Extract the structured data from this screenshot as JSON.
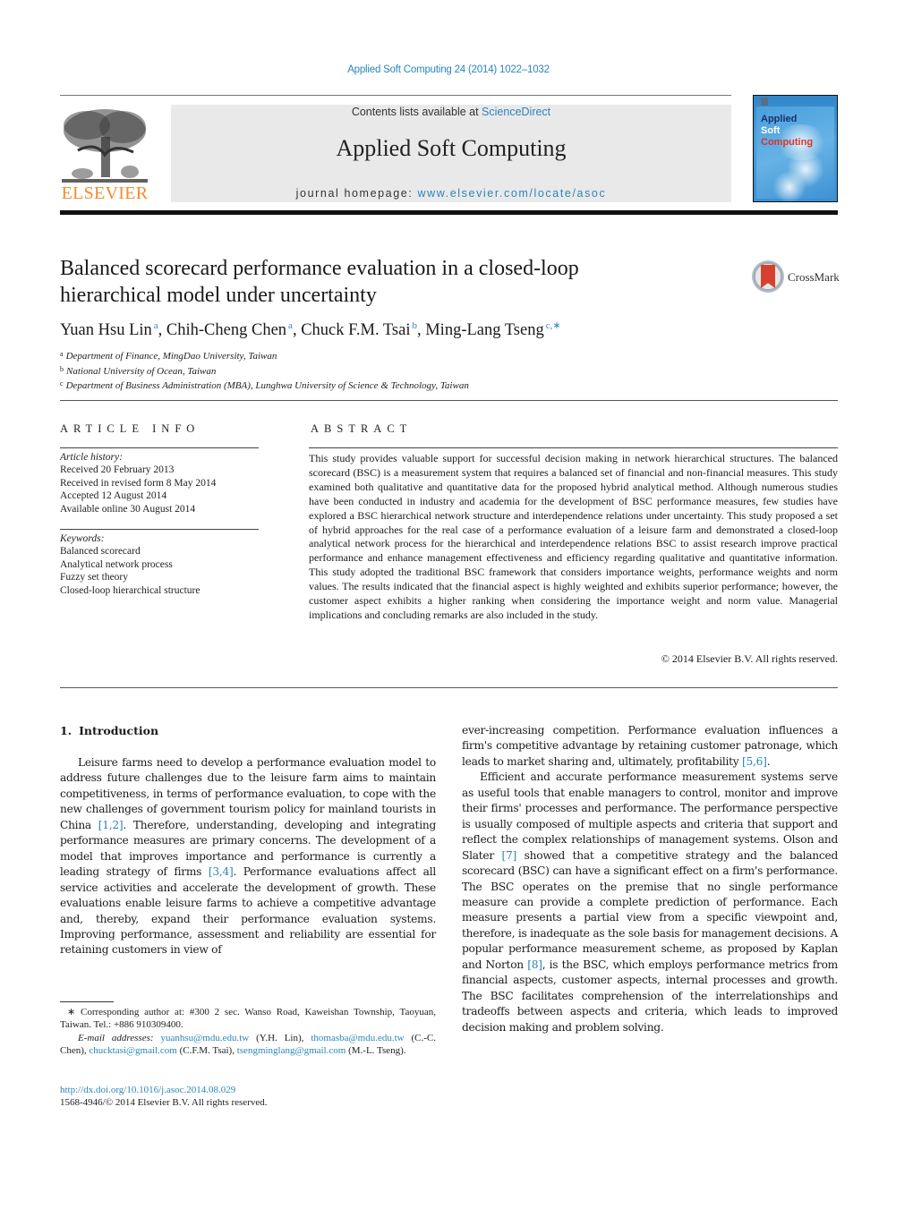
{
  "header": {
    "citation": "Applied Soft Computing 24 (2014) 1022–1032",
    "contents_prefix": "Contents lists available at ",
    "contents_link": "ScienceDirect",
    "journal_name": "Applied Soft Computing",
    "homepage_prefix": "journal homepage: ",
    "homepage_link": "www.elsevier.com/locate/asoc",
    "publisher_wordmark": "ELSEVIER",
    "cover": {
      "line1": "Applied",
      "line2": "Soft",
      "line3": "Computing",
      "colors": {
        "line1": "#1d2f6e",
        "line2": "#ffffff",
        "line3": "#d8352a",
        "background": "#3e93d3"
      }
    },
    "crossmark_label": "CrossMark"
  },
  "article": {
    "title_line1": "Balanced scorecard performance evaluation in a closed-loop",
    "title_line2": "hierarchical model under uncertainty",
    "authors": [
      {
        "name": "Yuan Hsu Lin",
        "sup": "a",
        "sep": ", "
      },
      {
        "name": "Chih-Cheng Chen",
        "sup": "a",
        "sep": ", "
      },
      {
        "name": "Chuck F.M. Tsai",
        "sup": "b",
        "sep": ", "
      },
      {
        "name": "Ming-Lang Tseng",
        "sup": "c,∗",
        "sep": ""
      }
    ],
    "affiliations": [
      {
        "sup": "a",
        "text": "Department of Finance, MingDao University, Taiwan"
      },
      {
        "sup": "b",
        "text": "National University of Ocean, Taiwan"
      },
      {
        "sup": "c",
        "text": "Department of Business Administration (MBA), Lunghwa University of Science & Technology, Taiwan"
      }
    ]
  },
  "article_info": {
    "heading": "ARTICLE INFO",
    "history_label": "Article history:",
    "history": [
      "Received 20 February 2013",
      "Received in revised form 8 May 2014",
      "Accepted 12 August 2014",
      "Available online 30 August 2014"
    ],
    "keywords_label": "Keywords:",
    "keywords": [
      "Balanced scorecard",
      "Analytical network process",
      "Fuzzy set theory",
      "Closed-loop hierarchical structure"
    ]
  },
  "abstract": {
    "heading": "ABSTRACT",
    "text": "This study provides valuable support for successful decision making in network hierarchical structures. The balanced scorecard (BSC) is a measurement system that requires a balanced set of financial and non-financial measures. This study examined both qualitative and quantitative data for the proposed hybrid analytical method. Although numerous studies have been conducted in industry and academia for the development of BSC performance measures, few studies have explored a BSC hierarchical network structure and interdependence relations under uncertainty. This study proposed a set of hybrid approaches for the real case of a performance evaluation of a leisure farm and demonstrated a closed-loop analytical network process for the hierarchical and interdependence relations BSC to assist research improve practical performance and enhance management effectiveness and efficiency regarding qualitative and quantitative information. This study adopted the traditional BSC framework that considers importance weights, performance weights and norm values. The results indicated that the financial aspect is highly weighted and exhibits superior performance; however, the customer aspect exhibits a higher ranking when considering the importance weight and norm value. Managerial implications and concluding remarks are also included in the study.",
    "copyright": "© 2014 Elsevier B.V. All rights reserved."
  },
  "body": {
    "section_number": "1.",
    "section_title": "Introduction",
    "left": {
      "p1_a": "Leisure farms need to develop a performance evaluation model to address future challenges due to the leisure farm aims to maintain competitiveness, in terms of performance evaluation, to cope with the new challenges of government tourism policy for mainland tourists in China ",
      "ref1": "[1,2]",
      "p1_b": ". Therefore, understanding, developing and integrating performance measures are primary concerns. The development of a model that improves importance and performance is currently a leading strategy of firms ",
      "ref2": "[3,4]",
      "p1_c": ". Performance evaluations affect all service activities and accelerate the development of growth. These evaluations enable leisure farms to achieve a competitive advantage and, thereby, expand their performance evaluation systems. Improving performance, assessment and reliability are essential for retaining customers in view of"
    },
    "right": {
      "p1_a": "ever-increasing competition. Performance evaluation influences a firm's competitive advantage by retaining customer patronage, which leads to market sharing and, ultimately, profitability ",
      "ref1": "[5,6]",
      "p1_b": ".",
      "p2_a": "Efficient and accurate performance measurement systems serve as useful tools that enable managers to control, monitor and improve their firms' processes and performance. The performance perspective is usually composed of multiple aspects and criteria that support and reflect the complex relationships of management systems. Olson and Slater ",
      "ref2": "[7]",
      "p2_b": " showed that a competitive strategy and the balanced scorecard (BSC) can have a significant effect on a firm's performance. The BSC operates on the premise that no single performance measure can provide a complete prediction of performance. Each measure presents a partial view from a specific viewpoint and, therefore, is inadequate as the sole basis for management decisions. A popular performance measurement scheme, as proposed by Kaplan and Norton ",
      "ref3": "[8]",
      "p2_c": ", is the BSC, which employs performance metrics from financial aspects, customer aspects, internal processes and growth. The BSC facilitates comprehension of the interrelationships and tradeoffs between aspects and criteria, which leads to improved decision making and problem solving."
    }
  },
  "footnote": {
    "corresponding": "∗  Corresponding author at: #300 2 sec. Wanso Road, Kaweishan Township, Taoyuan, Taiwan. Tel.: +886 910309400.",
    "email_label": "E-mail addresses:",
    "emails": [
      {
        "address": "yuanhsu@mdu.edu.tw",
        "who": " (Y.H. Lin), "
      },
      {
        "address": "thomasba@mdu.edu.tw",
        "who": " (C.-C. Chen), "
      },
      {
        "address": "chucktasi@gmail.com",
        "who": " (C.F.M. Tsai), "
      },
      {
        "address": "tsengminglang@gmail.com",
        "who": " (M.-L. Tseng)."
      }
    ],
    "doi": "http://dx.doi.org/10.1016/j.asoc.2014.08.029",
    "issn": "1568-4946/© 2014 Elsevier B.V. All rights reserved."
  }
}
